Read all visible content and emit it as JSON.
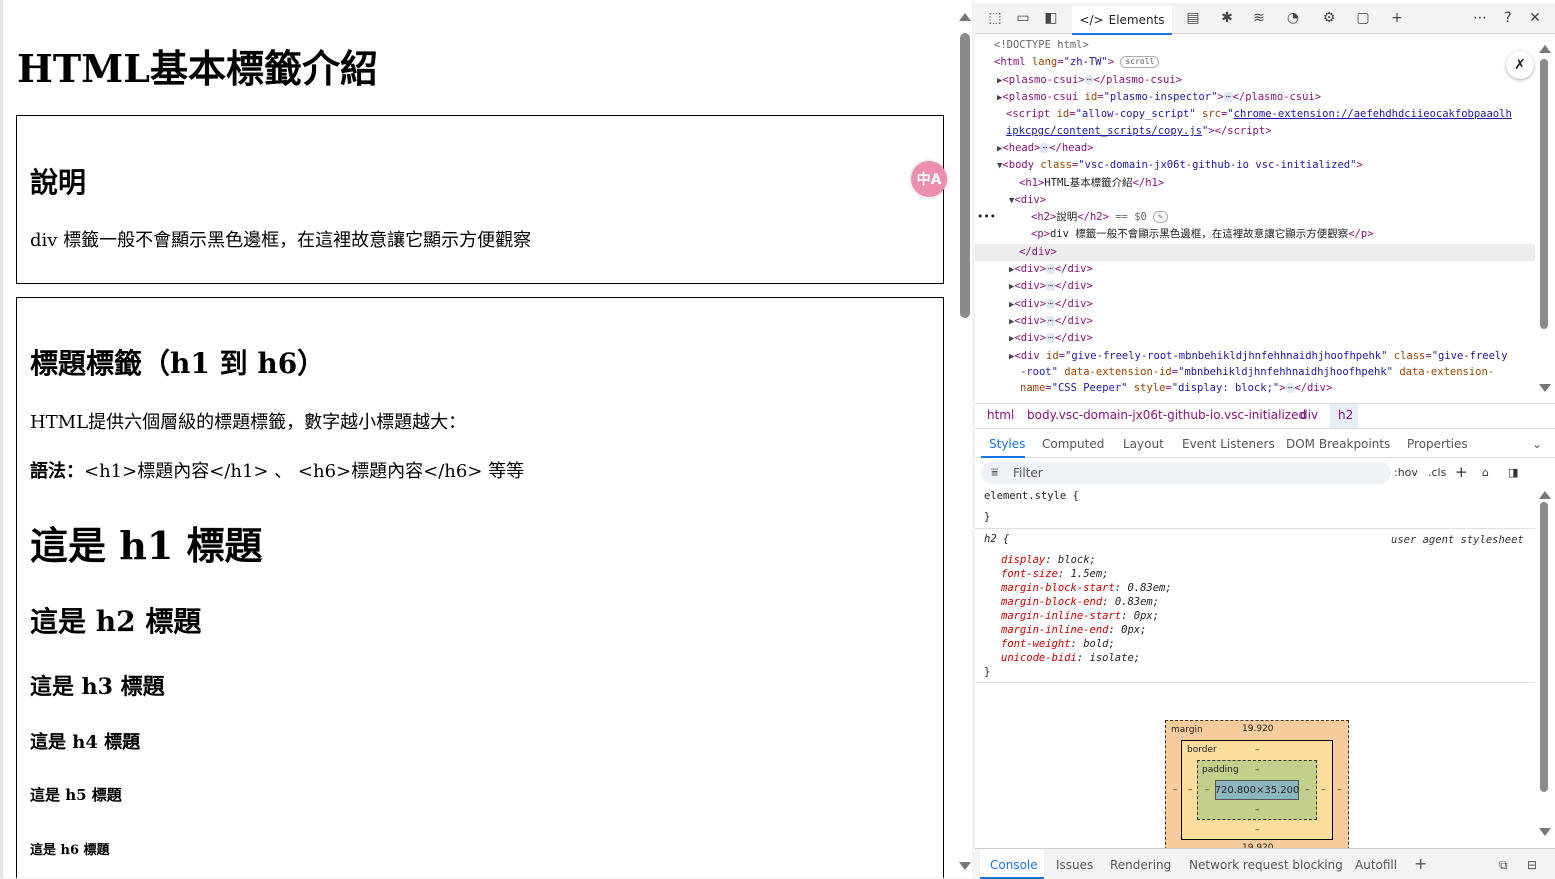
{
  "page": {
    "h1": "HTML基本標籤介紹",
    "section1": {
      "title": "說明",
      "text": "div 標籤一般不會顯示黑色邊框，在這裡故意讓它顯示方便觀察"
    },
    "section2": {
      "title": "標題標籤（h1 到 h6）",
      "intro": "HTML提供六個層級的標題標籤，數字越小標題越大：",
      "syntax_label": "語法：",
      "syntax_text": "<h1>標題內容</h1> 、 <h6>標題內容</h6> 等等",
      "h1": "這是 h1 標題",
      "h2": "這是 h2 標題",
      "h3": "這是 h3 標題",
      "h4": "這是 h4 標題",
      "h5": "這是 h5 標題",
      "h6": "這是 h6 標題"
    },
    "translate_icon_text": "中A"
  },
  "devtools": {
    "toolbar": {
      "elements_tab": "Elements",
      "icons": [
        "inspect-icon",
        "device-icon",
        "dock-icon",
        "console-drawer-icon",
        "bug-icon",
        "network-icon",
        "performance-icon",
        "settings-gear-icon",
        "application-icon",
        "more-tabs-icon",
        "more-menu-icon",
        "help-icon",
        "close-icon"
      ]
    },
    "elements": {
      "doctype": "<!DOCTYPE html>",
      "html_tag": "<html",
      "lang_attr": "lang",
      "lang_val": "\"zh-TW\"",
      "scroll_badge": "scroll",
      "plasmo1": "plasmo-csui",
      "plasmo2_open": "plasmo-csui",
      "id_attr": "id",
      "plasmo2_id": "\"plasmo-inspector\"",
      "script_id": "\"allow-copy_script\"",
      "src_attr": "src",
      "script_src_1": "chrome-extension://aefehdhdciieocakfobpaaolh",
      "script_src_2": "ipkcpgc/content_scripts/copy.js",
      "head": "head",
      "body_class_attr": "class",
      "body_class": "\"vsc-domain-jx06t-github-io vsc-initialized\"",
      "h1_text": "HTML基本標籤介紹",
      "h2_text": "說明",
      "eq0": " == $0",
      "p_text": "div 標籤一般不會顯示黑色邊框，在這裡故意讓它顯示方便觀察",
      "gf_id": "\"give-freely-root-mbnbehikldjhnfehhnaidhjhoofhpehk\"",
      "gf_class": "\"give-freely",
      "gf_class2": "-root\"",
      "gf_ext_attr": "data-extension-id",
      "gf_ext": "\"mbnbehikldjhnfehhnaidhjhoofhpehk\"",
      "gf_ext2_attr": "data-extension-",
      "gf_name_attr": "name",
      "gf_name": "\"CSS Peeper\"",
      "gf_style_attr": "style",
      "gf_style": "\"display: block;\"",
      "ellipsis": "⋯"
    },
    "breadcrumb": [
      "html",
      "body.vsc-domain-jx06t-github-io.vsc-initialized",
      "div",
      "h2"
    ],
    "style_tabs": [
      "Styles",
      "Computed",
      "Layout",
      "Event Listeners",
      "DOM Breakpoints",
      "Properties"
    ],
    "filter_placeholder": "Filter",
    "hov": ":hov",
    "cls": ".cls",
    "rules": {
      "element_style": "element.style {",
      "close": "}",
      "h2_selector": "h2 {",
      "ua": "user agent stylesheet",
      "props": [
        {
          "n": "display",
          "v": "block;"
        },
        {
          "n": "font-size",
          "v": "1.5em;"
        },
        {
          "n": "margin-block-start",
          "v": "0.83em;"
        },
        {
          "n": "margin-block-end",
          "v": "0.83em;"
        },
        {
          "n": "margin-inline-start",
          "v": "0px;"
        },
        {
          "n": "margin-inline-end",
          "v": "0px;"
        },
        {
          "n": "font-weight",
          "v": "bold;"
        },
        {
          "n": "unicode-bidi",
          "v": "isolate;"
        }
      ]
    },
    "boxmodel": {
      "margin_label": "margin",
      "margin_val": "19.920",
      "border_label": "border",
      "padding_label": "padding",
      "dash": "–",
      "content": "720.800×35.200",
      "margin_bottom": "19.920"
    },
    "drawer_tabs": [
      "Console",
      "Issues",
      "Rendering",
      "Network request blocking",
      "Autofill"
    ]
  },
  "colors": {
    "tag": "#881280",
    "attr_name": "#994500",
    "attr_value": "#1a1aa6",
    "accent": "#1a73e8",
    "translate": "#ec8fae"
  }
}
